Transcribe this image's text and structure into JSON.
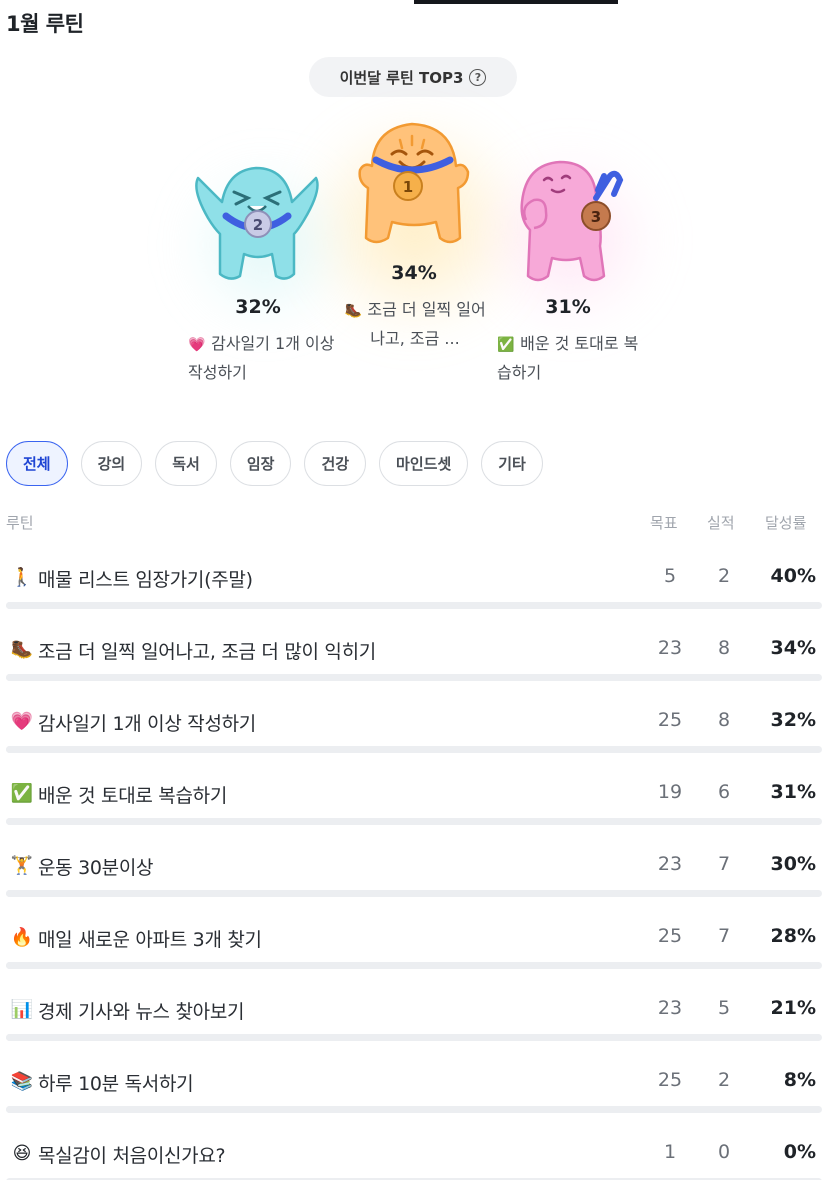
{
  "page": {
    "title": "1월 루틴"
  },
  "top3": {
    "label": "이번달 루틴 TOP3",
    "help_icon": "question-circle-icon",
    "podium": [
      {
        "rank": "2",
        "percent": "32%",
        "emoji": "💗",
        "label": "감사일기 1개 이상 작성하기",
        "label_display": "감사일기 1개 이상 작성하기"
      },
      {
        "rank": "1",
        "percent": "34%",
        "emoji": "🥾",
        "label": "조금 더 일찍 일어나고, 조금 ...",
        "label_display": "조금 더 일찍 일어나고, 조금 ..."
      },
      {
        "rank": "3",
        "percent": "31%",
        "emoji": "✅",
        "label": "배운 것 토대로 복습하기",
        "label_display": "배운 것 토대로 복습하기"
      }
    ]
  },
  "tabs": [
    {
      "label": "전체",
      "active": true
    },
    {
      "label": "강의",
      "active": false
    },
    {
      "label": "독서",
      "active": false
    },
    {
      "label": "임장",
      "active": false
    },
    {
      "label": "건강",
      "active": false
    },
    {
      "label": "마인드셋",
      "active": false
    },
    {
      "label": "기타",
      "active": false
    }
  ],
  "table": {
    "headers": {
      "name": "루틴",
      "goal": "목표",
      "done": "실적",
      "rate": "달성률"
    },
    "rows": [
      {
        "emoji": "🚶",
        "name": "매물 리스트 임장가기(주말)",
        "goal": "5",
        "done": "2",
        "rate": "40%"
      },
      {
        "emoji": "🥾",
        "name": "조금 더 일찍 일어나고, 조금 더 많이 익히기",
        "goal": "23",
        "done": "8",
        "rate": "34%"
      },
      {
        "emoji": "💗",
        "name": "감사일기 1개 이상 작성하기",
        "goal": "25",
        "done": "8",
        "rate": "32%"
      },
      {
        "emoji": "✅",
        "name": "배운 것 토대로 복습하기",
        "goal": "19",
        "done": "6",
        "rate": "31%"
      },
      {
        "emoji": "🏋",
        "name": "운동 30분이상",
        "goal": "23",
        "done": "7",
        "rate": "30%"
      },
      {
        "emoji": "🔥",
        "name": "매일 새로운 아파트 3개 찾기",
        "goal": "25",
        "done": "7",
        "rate": "28%"
      },
      {
        "emoji": "📊",
        "name": "경제 기사와 뉴스 찾아보기",
        "goal": "23",
        "done": "5",
        "rate": "21%"
      },
      {
        "emoji": "📚",
        "name": "하루 10분 독서하기",
        "goal": "25",
        "done": "2",
        "rate": "8%"
      },
      {
        "emoji": "😆",
        "name": "목실감이 처음이신가요?",
        "goal": "1",
        "done": "0",
        "rate": "0%"
      }
    ]
  },
  "colors": {
    "accent": "#3a64f0",
    "rank1": "#f7a93a",
    "rank2": "#79d3dd",
    "rank3": "#f28bc8",
    "medal_ribbon": "#3f5fe0"
  }
}
